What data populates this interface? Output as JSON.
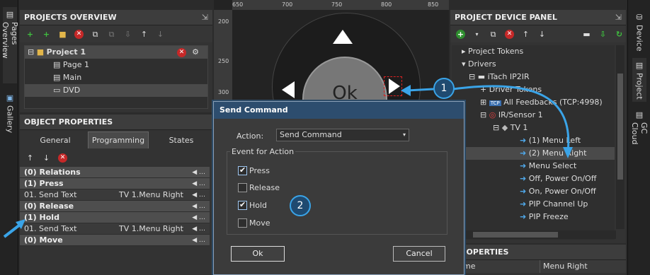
{
  "left_strip": {
    "pages_overview": "Pages Overview",
    "gallery": "Gallery"
  },
  "projects_overview": {
    "title": "PROJECTS OVERVIEW",
    "tree": [
      "Project 1",
      "Page 1",
      "Main",
      "DVD"
    ]
  },
  "object_properties": {
    "title": "OBJECT PROPERTIES",
    "tabs": [
      "General",
      "Programming",
      "States"
    ],
    "rows": [
      {
        "kind": "section",
        "label": "(0) Relations"
      },
      {
        "kind": "section",
        "label": "(1) Press"
      },
      {
        "kind": "row",
        "label": "01. Send Text",
        "value": "TV 1.Menu Right"
      },
      {
        "kind": "section",
        "label": "(0) Release"
      },
      {
        "kind": "section",
        "label": "(1) Hold"
      },
      {
        "kind": "row",
        "label": "01. Send Text",
        "value": "TV 1.Menu Right"
      },
      {
        "kind": "section",
        "label": "(0) Move"
      }
    ]
  },
  "canvas": {
    "ruler_x": [
      "650",
      "700",
      "750",
      "800",
      "850"
    ],
    "ruler_y": [
      "200",
      "250",
      "300"
    ],
    "ok_label": "Ok"
  },
  "device_panel": {
    "title": "PROJECT DEVICE PANEL",
    "tree": [
      "Project Tokens",
      "Drivers",
      "iTach IP2IR",
      "Driver Tokens",
      "All Feedbacks (TCP:4998)",
      "IR/Sensor 1",
      "TV 1",
      "(1) Menu Left",
      "(2) Menu Right",
      "Menu Select",
      "Off, Power On/Off",
      "On, Power On/Off",
      "PIP Channel Up",
      "PIP Freeze"
    ],
    "tcp_tag": "TCP"
  },
  "bottom_props": {
    "title": "PROPERTIES",
    "col_name": "me",
    "col_value": "Menu Right"
  },
  "right_strip": {
    "device": "Device",
    "project": "Project",
    "gc_cloud": "GC Cloud"
  },
  "dialog": {
    "title": "Send Command",
    "action_label": "Action:",
    "action_value": "Send Command",
    "group_label": "Event for Action",
    "events": [
      {
        "label": "Press",
        "checked": true
      },
      {
        "label": "Release",
        "checked": false
      },
      {
        "label": "Hold",
        "checked": true
      },
      {
        "label": "Move",
        "checked": false
      }
    ],
    "ok": "Ok",
    "cancel": "Cancel"
  },
  "callouts": [
    "1",
    "2"
  ],
  "colors": {
    "accent": "#3aa4e8",
    "panel": "#3a3a3a",
    "dialog_title": "#2d4d6e"
  }
}
